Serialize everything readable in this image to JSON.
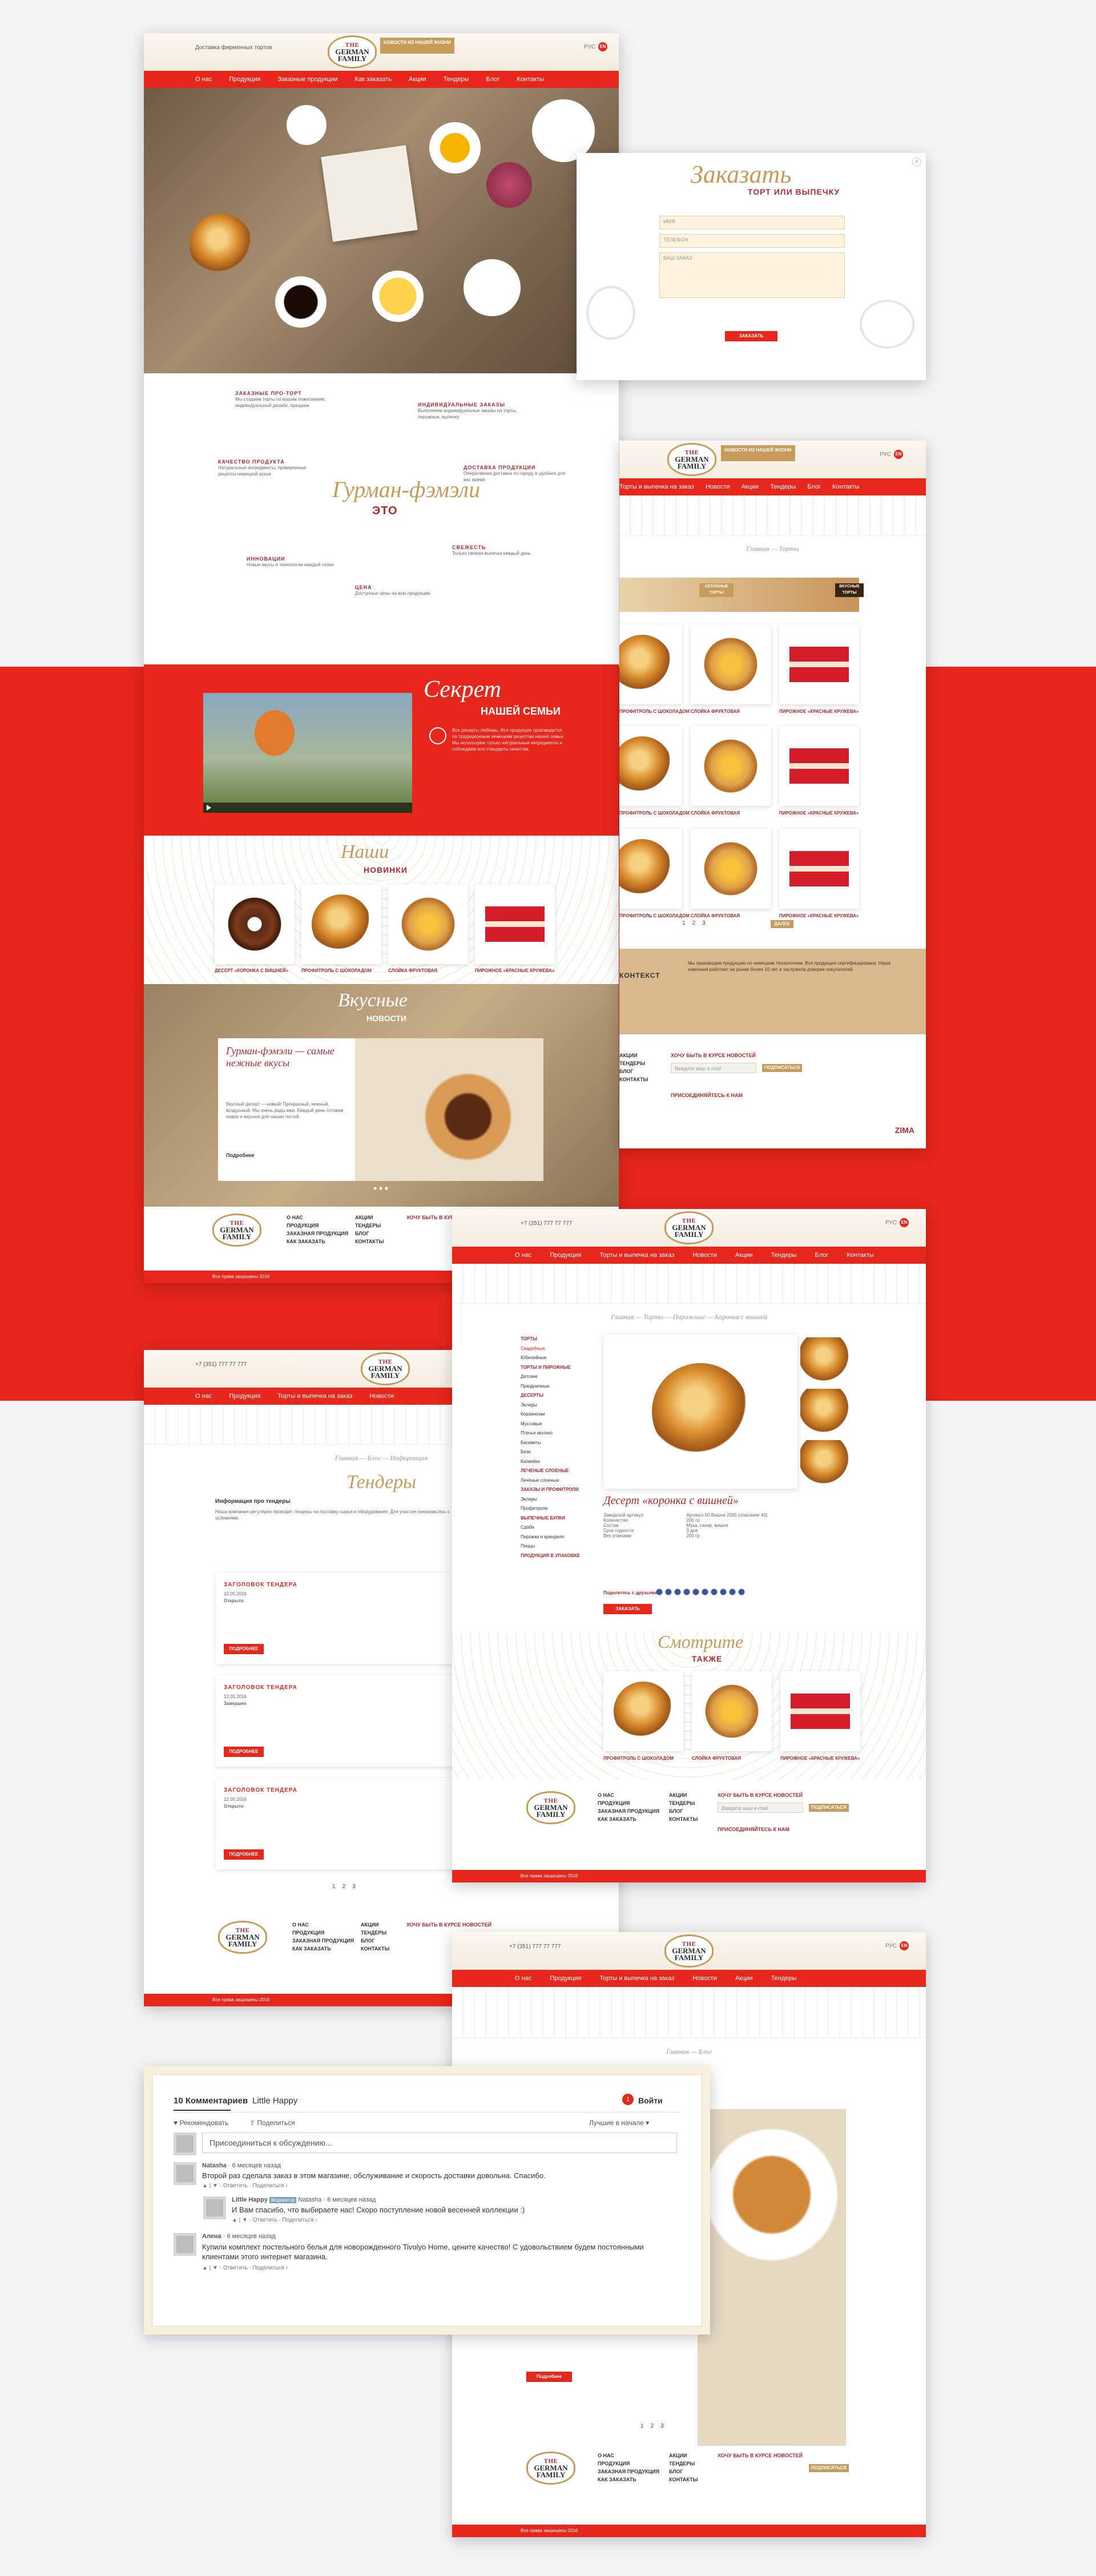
{
  "brand": {
    "line1": "THE",
    "line2": "GERMAN",
    "line3": "FAMILY",
    "sub": "БЕКАРЕЯ"
  },
  "header": {
    "badge": "НОВОСТИ ИЗ\nНАШЕЙ ЖИЗНИ",
    "phone": "+7 (351) 777 77 777",
    "phone2": "(495) 777 77 777",
    "lang_rus": "РУС",
    "lang_eng": "ENG",
    "delivery": "Доставка фирменных тортов"
  },
  "nav": [
    "О нас",
    "Продукция",
    "Заказные продукции",
    "Как заказать",
    "Акции",
    "Тендеры",
    "Блог",
    "Контакты"
  ],
  "nav_alt": [
    "О нас",
    "Продукция",
    "Торты и выпечка на заказ",
    "Новости",
    "Акции",
    "Тендеры",
    "Блог",
    "Контакты"
  ],
  "order_modal": {
    "title_script": "Заказать",
    "title_caps": "ТОРТ ИЛИ ВЫПЕЧКУ",
    "name_placeholder": "ИМЯ",
    "phone_placeholder": "ТЕЛЕФОН",
    "order_placeholder": "ВАШ ЗАКАЗ",
    "submit": "ЗАКАЗАТЬ"
  },
  "features": {
    "center_script": "Гурман-фэмэли",
    "center_caps": "ЭТО",
    "items": [
      {
        "title": "ЗАКАЗНЫЕ ПРО-ТОРТ",
        "text": "Мы создаем торты по вашим пожеланиям, индивидуальный дизайн, праздник"
      },
      {
        "title": "ИНДИВИДУАЛЬНЫЕ ЗАКАЗЫ",
        "text": "Выполняем индивидуальные заказы на торты, пирожные, выпечку"
      },
      {
        "title": "КАЧЕСТВО ПРОДУКТА",
        "text": "Натуральные ингредиенты, проверенные рецепты немецкой кухни"
      },
      {
        "title": "ДОСТАВКА ПРОДУКЦИИ",
        "text": "Оперативная доставка по городу в удобное для вас время"
      },
      {
        "title": "ИННОВАЦИИ",
        "text": "Новые вкусы и технологии каждый сезон"
      },
      {
        "title": "ЦЕНА",
        "text": "Доступные цены на всю продукцию"
      },
      {
        "title": "СВЕЖЕСТЬ",
        "text": "Только свежая выпечка каждый день"
      }
    ]
  },
  "secret": {
    "script": "Секрет",
    "caps": "НАШЕЙ СЕМЬИ",
    "text": "Все десерты любимы. Вся продукция производится по традиционным немецким рецептам нашей семьи. Мы используем только натуральные ингредиенты и соблюдаем все стандарты качества."
  },
  "novelties": {
    "script": "Наши",
    "caps": "НОВИНКИ",
    "items": [
      "ДЕСЕРТ «КОРОНКА С ВИШНЕЙ»",
      "ПРОФИТРОЛЬ С ШОКОЛАДОМ",
      "СЛОЙКА ФРУКТОВАЯ",
      "ПИРОЖНОЕ «КРАСНЫЕ КРУЖЕВА»"
    ]
  },
  "news": {
    "script": "Вкусные",
    "caps": "НОВОСТИ",
    "quote": "Гурман-фэмэли — самые нежные вкусы",
    "text": "Вкусный десерт — новый! Прекрасный, нежный, воздушный. Мы очень рады вам. Каждый день готовим новое и вкусное для наших гостей.",
    "more": "Подробнее"
  },
  "footer": {
    "links1": [
      "О НАС",
      "ПРОДУКЦИЯ",
      "ЗАКАЗНАЯ ПРОДУКЦИЯ",
      "КАК ЗАКАЗАТЬ"
    ],
    "links2": [
      "АКЦИИ",
      "ТЕНДЕРЫ",
      "БЛОГ",
      "КОНТАКТЫ"
    ],
    "subscribe_title": "ХОЧУ БЫТЬ В КУРСЕ НОВОСТЕЙ",
    "email_placeholder": "Введите ваш e-mail",
    "subscribe_btn": "ПОДПИСАТЬСЯ",
    "social_title": "ПРИСОЕДИНЯЙТЕСЬ К НАМ",
    "copyright": "Все права защищены 2016",
    "dev": "ZIMA"
  },
  "catalog": {
    "crumbs": "Главная — Торты",
    "banner1": "СЕЗОННЫЕ ТОРТЫ",
    "banner2": "ВКУСНЫЕ ТОРТЫ",
    "items": [
      "ПРОФИТРОЛЬ С ШОКОЛАДОМ",
      "СЛОЙКА ФРУКТОВАЯ",
      "ПИРОЖНОЕ «КРАСНЫЕ КРУЖЕВА»"
    ],
    "pages": [
      "1",
      "2",
      "3"
    ],
    "next": "ДАЛЕЕ",
    "context_title": "КОНТЕКСТ",
    "context_text": "Мы производим продукцию по немецким технологиям. Вся продукция сертифицирована. Наша компания работает на рынке более 10 лет и заслужила доверие покупателей."
  },
  "product": {
    "crumbs": "Главная — Торты — Пирожные — Коронка с вишней",
    "name": "Десерт «коронка с вишней»",
    "specs": [
      [
        "Заводской артикул",
        "Артикул 00 Вишня 2000 (описание 40)"
      ],
      [
        "Количество",
        "200 гр"
      ],
      [
        "Состав",
        "Мука, сахар, вишня"
      ],
      [
        "Срок годности",
        "3 дня"
      ],
      [
        "Вес упаковки",
        "200 гр"
      ]
    ],
    "order_btn": "ЗАКАЗАТЬ",
    "share": "Поделитесь с друзьями",
    "see_script": "Смотрите",
    "see_caps": "ТАКЖЕ",
    "sidebar": [
      "ТОРТЫ",
      "Свадебные",
      "Юбилейные",
      "ТОРТЫ И ПИРОЖНЫЕ",
      "Детские",
      "Праздничные",
      "ДЕСЕРТЫ",
      "Эклеры",
      "Корзиночки",
      "Муссовые",
      "Птичье молоко",
      "Бисквиты",
      "Бизе",
      "Капкейки",
      "ЛЕЧЕНЫЕ СЛОЕНЫЕ",
      "Лечёные слоеные",
      "ЗАКАЗЫ И ПРОФИТРОЛИ",
      "Эклеры",
      "Профитроли",
      "ВЫПЕЧНЫЕ БУЛКИ",
      "Сдоба",
      "Пирожки и кренделя",
      "Пиццы",
      "ПРОДУКЦИЯ В УПАКОВКЕ"
    ]
  },
  "tenders": {
    "crumbs": "Главная — Блог — Информация",
    "script": "Тендеры",
    "info_title": "Информация про тендеры",
    "info_text": "Наша компания регулярно проводит тендеры на поставку сырья и оборудования. Для участия ознакомьтесь с условиями.",
    "items": [
      {
        "title": "ЗАГОЛОВОК ТЕНДЕРА",
        "date": "12.05.2016",
        "status": "Открыто"
      },
      {
        "title": "ЗАГОЛОВОК ТЕНДЕРА",
        "date": "12.05.2016",
        "status": "Завершен"
      },
      {
        "title": "ЗАГОЛОВОК ТЕНДЕРА",
        "date": "12.05.2016",
        "status": "Открыто"
      }
    ],
    "more": "ПОДРОБНЕЕ"
  },
  "blog": {
    "crumbs": "Главная — Блог",
    "script": "Вкусные"
  },
  "comments": {
    "count_label": "10 Комментариев",
    "site": "Little Happy",
    "login": "Войти",
    "recommend": "Рекомендовать",
    "share": "Поделиться",
    "sort": "Лучшие в начале",
    "placeholder": "Присоединиться к обсуждению...",
    "list": [
      {
        "author": "Natasha",
        "time": "6 месяцев назад",
        "text": "Второй раз сделала заказ в этом магазине, обслуживание и скорость доставки довольна. Спасибо.",
        "actions": "Ответить · Поделиться ›",
        "reply": false
      },
      {
        "author": "Little Happy",
        "badge": "Модератор",
        "time": "Natasha · 6 месяцев назад",
        "text": "И Вам спасибо, что выбираете нас! Скоро поступление новой весенней коллекции :)",
        "actions": "Ответить · Поделиться ›",
        "reply": true
      },
      {
        "author": "Алена",
        "time": "6 месяцев назад",
        "text": "Купили комплект постельного белья для новорожденного Tivolyo Home, цените качество! С удовольствием будем постоянными клиентами этого интернет магазина.",
        "actions": "Ответить · Поделиться ›",
        "reply": false
      }
    ]
  },
  "colors": {
    "brand_red": "#e7261c",
    "gold": "#c79b5a",
    "dark_red": "#b3282d"
  }
}
